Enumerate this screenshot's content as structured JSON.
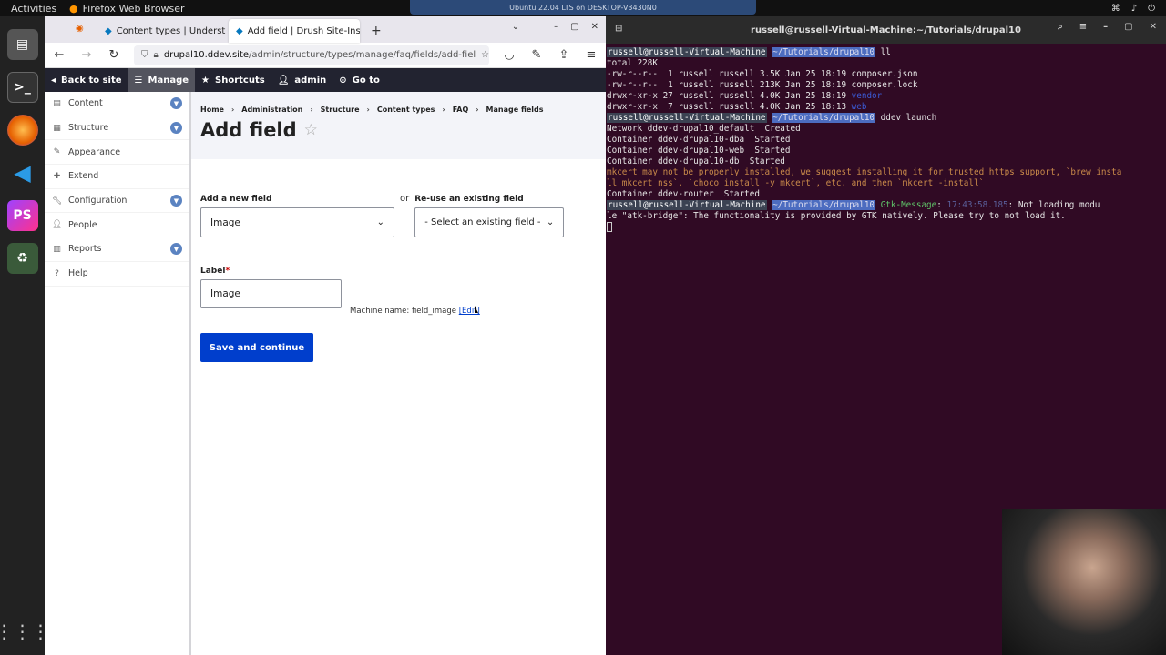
{
  "system": {
    "activities": "Activities",
    "app_name": "Firefox Web Browser",
    "vm_title": "Ubuntu 22.04 LTS on DESKTOP-V3430N0"
  },
  "browser": {
    "tabs": [
      {
        "label": "Content types | Underst"
      },
      {
        "label": "Add field | Drush Site-Ins"
      }
    ],
    "url_domain": "drupal10.ddev.site",
    "url_path": "/admin/structure/types/manage/faq/fields/add-fiel"
  },
  "admin_toolbar": {
    "back_to_site": "Back to site",
    "manage": "Manage",
    "shortcuts": "Shortcuts",
    "user": "admin",
    "goto": "Go to"
  },
  "admin_tray": {
    "items": [
      {
        "label": "Content",
        "icon": "content-icon",
        "expandable": true
      },
      {
        "label": "Structure",
        "icon": "structure-icon",
        "expandable": true
      },
      {
        "label": "Appearance",
        "icon": "appearance-icon",
        "expandable": false
      },
      {
        "label": "Extend",
        "icon": "extend-icon",
        "expandable": false
      },
      {
        "label": "Configuration",
        "icon": "configuration-icon",
        "expandable": true
      },
      {
        "label": "People",
        "icon": "people-icon",
        "expandable": false
      },
      {
        "label": "Reports",
        "icon": "reports-icon",
        "expandable": true
      },
      {
        "label": "Help",
        "icon": "help-icon",
        "expandable": false
      }
    ]
  },
  "page": {
    "breadcrumb": [
      "Home",
      "Administration",
      "Structure",
      "Content types",
      "FAQ",
      "Manage fields"
    ],
    "title": "Add field",
    "add_new_label": "Add a new field",
    "add_new_value": "Image",
    "or_label": "or",
    "reuse_label": "Re-use an existing field",
    "reuse_value": "- Select an existing field -",
    "label_label": "Label",
    "label_required": "*",
    "label_value": "Image",
    "machine_name_prefix": "Machine name: field_image",
    "machine_name_edit": "[Edit]",
    "save_button": "Save and continue"
  },
  "terminal": {
    "title": "russell@russell-Virtual-Machine:~/Tutorials/drupal10",
    "prompt_user": "russell@russell-Virtual-Machine",
    "prompt_path": "~/Tutorials/drupal10",
    "lines": [
      {
        "type": "prompt",
        "cmd": " ll"
      },
      {
        "type": "text",
        "text": "total 228K"
      },
      {
        "type": "text",
        "text": "-rw-r--r--  1 russell russell 3.5K Jan 25 18:19 composer.json"
      },
      {
        "type": "text",
        "text": "-rw-r--r--  1 russell russell 213K Jan 25 18:19 composer.lock"
      },
      {
        "type": "dir",
        "text": "drwxr-xr-x 27 russell russell 4.0K Jan 25 18:19 ",
        "name": "vendor"
      },
      {
        "type": "dir",
        "text": "drwxr-xr-x  7 russell russell 4.0K Jan 25 18:13 ",
        "name": "web"
      },
      {
        "type": "prompt",
        "cmd": " ddev launch"
      },
      {
        "type": "text",
        "text": "Network ddev-drupal10_default  Created"
      },
      {
        "type": "text",
        "text": "Container ddev-drupal10-dba  Started"
      },
      {
        "type": "text",
        "text": "Container ddev-drupal10-web  Started"
      },
      {
        "type": "text",
        "text": "Container ddev-drupal10-db  Started"
      },
      {
        "type": "warn",
        "text": "mkcert may not be properly installed, we suggest installing it for trusted https support, `brew insta"
      },
      {
        "type": "warn",
        "text": "ll mkcert nss`, `choco install -y mkcert`, etc. and then `mkcert -install`"
      },
      {
        "type": "text",
        "text": "Container ddev-router  Started"
      },
      {
        "type": "gtk",
        "label": "Gtk-Message",
        "time": "17:43:58.185",
        "text": ": Not loading modu"
      },
      {
        "type": "text",
        "text": "le \"atk-bridge\": The functionality is provided by GTK natively. Please try to not load it."
      }
    ]
  }
}
